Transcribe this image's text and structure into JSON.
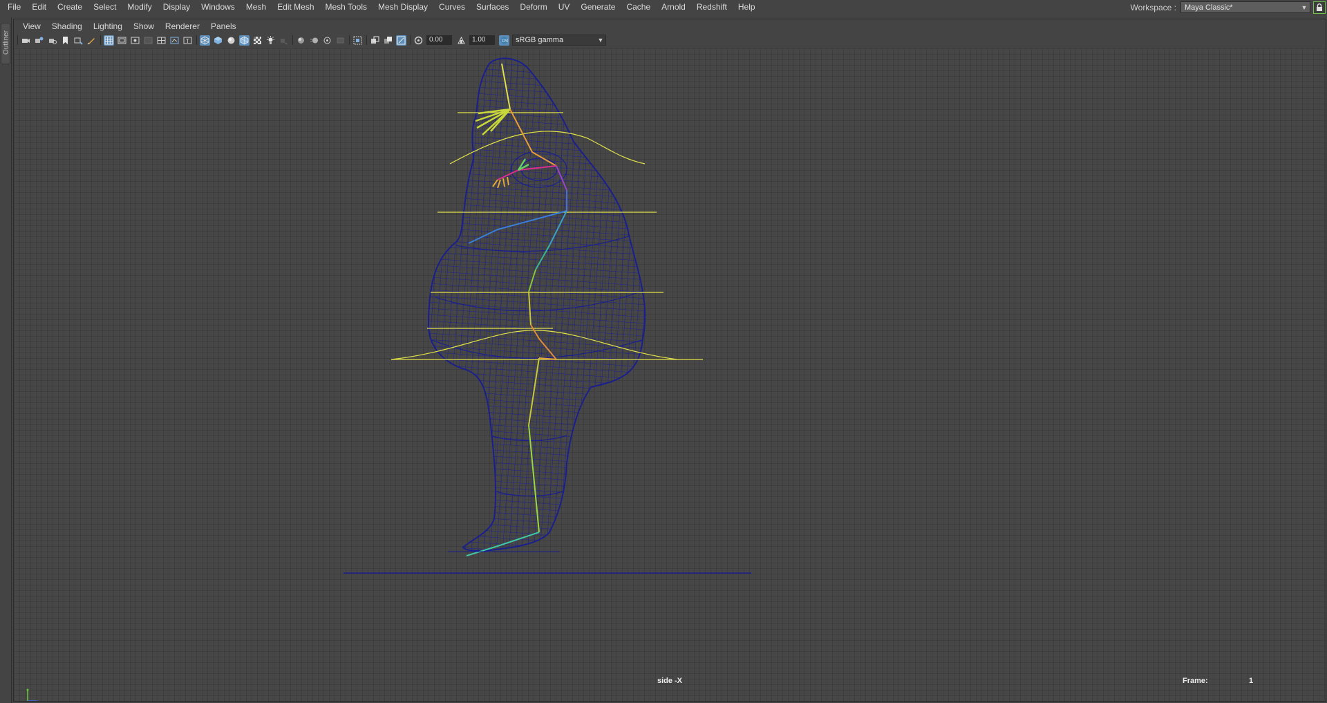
{
  "menubar": {
    "items": [
      "File",
      "Edit",
      "Create",
      "Select",
      "Modify",
      "Display",
      "Windows",
      "Mesh",
      "Edit Mesh",
      "Mesh Tools",
      "Mesh Display",
      "Curves",
      "Surfaces",
      "Deform",
      "UV",
      "Generate",
      "Cache",
      "Arnold",
      "Redshift",
      "Help"
    ]
  },
  "workspace": {
    "label": "Workspace :",
    "value": "Maya Classic*"
  },
  "outliner": {
    "label": "Outliner"
  },
  "panel": {
    "menu": [
      "View",
      "Shading",
      "Lighting",
      "Show",
      "Renderer",
      "Panels"
    ],
    "toolbar": {
      "exposure": "0.00",
      "gamma": "1.00",
      "color_management": "sRGB gamma"
    }
  },
  "viewport": {
    "camera": "side -X",
    "frame_label": "Frame:",
    "frame_value": "1"
  },
  "colors": {
    "wireframe": "#1a1f8c",
    "curves": "#e2e24a",
    "selection": "#5b8db8",
    "lock_outline": "#6cc24a"
  },
  "icons": {
    "toolbar": [
      "select-camera-icon",
      "camera-attributes-icon",
      "bookmark-icon",
      "image-plane-icon",
      "2d-pan-icon",
      "grease-pencil-icon",
      "grid-icon",
      "film-gate-icon",
      "resolution-gate-icon",
      "gate-mask-icon",
      "field-chart-icon",
      "safe-action-icon",
      "safe-title-icon",
      "wireframe-icon",
      "smooth-shade-icon",
      "use-default-material-icon",
      "wireframe-on-shaded-icon",
      "textured-icon",
      "use-all-lights-icon",
      "shadows-icon",
      "screen-space-ao-icon",
      "motion-blur-icon",
      "anti-aliasing-icon",
      "depth-of-field-icon",
      "isolate-select-icon",
      "xray-icon",
      "xray-active-components-icon",
      "xray-joints-icon",
      "exposure-icon",
      "gamma-icon",
      "color-management-icon"
    ]
  }
}
